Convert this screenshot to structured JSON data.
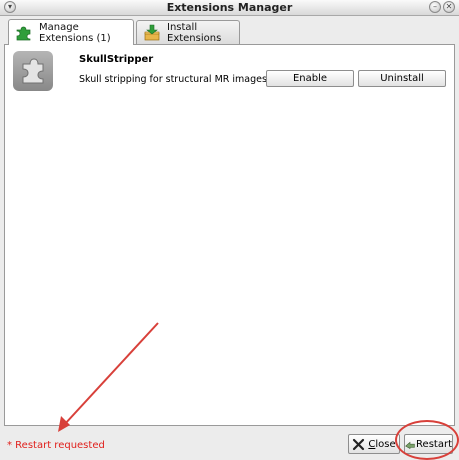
{
  "window": {
    "title": "Extensions Manager"
  },
  "tabs": [
    {
      "label": "Manage Extensions (1)",
      "icon": "puzzle-icon",
      "active": true
    },
    {
      "label": "Install Extensions",
      "icon": "install-box-icon",
      "active": false
    }
  ],
  "extension": {
    "name": "SkullStripper",
    "description": "Skull stripping for structural MR images of t...",
    "icon": "puzzle-gray-icon",
    "enable_label": "Enable",
    "uninstall_label": "Uninstall"
  },
  "footer": {
    "status_text": "* Restart requested",
    "close_label_first": "C",
    "close_label_rest": "lose",
    "restart_label": "Restart"
  },
  "colors": {
    "status_red": "#e0201c",
    "annotation_red": "#d8403a",
    "puzzle_green": "#2f9e3a"
  }
}
